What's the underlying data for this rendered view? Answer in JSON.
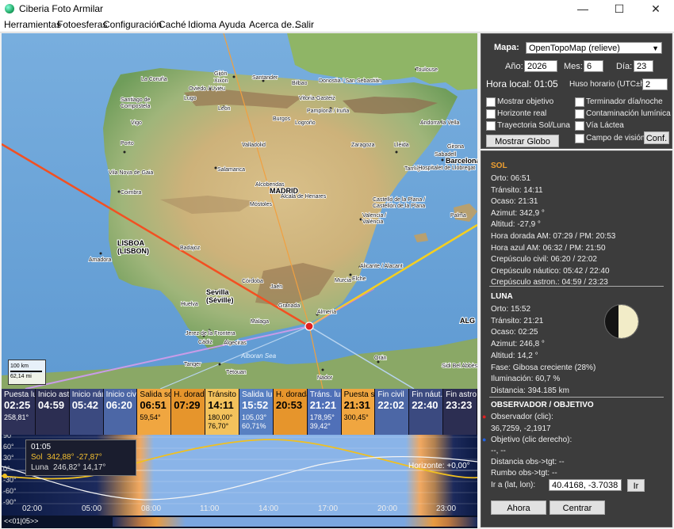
{
  "window": {
    "title": "Ciberia Foto Armilar",
    "min": "—",
    "max": "☐",
    "close": "✕"
  },
  "menu": [
    "Herramientas",
    "Fotoesferas",
    "Configuración",
    "Caché",
    "Idioma",
    "Ayuda",
    "Acerca de...",
    "Salir"
  ],
  "map": {
    "cities": [
      "Gijón",
      "Xixón",
      "La Coruña",
      "Oviedo / Uviéu",
      "Santander",
      "Bilbao",
      "Donostia / San Sebastián",
      "Toulouse",
      "Santiago de Compostela",
      "León",
      "Vitoria-Gasteiz",
      "Pamplona / Iruña",
      "Lugo",
      "Burgos",
      "Logroño",
      "Vigo",
      "Zaragoza",
      "Andorra la Vella",
      "Porto",
      "Valladolid",
      "Lleida",
      "Girona",
      "Vila Nova de Gaia",
      "Salamanca",
      "Tarragona",
      "Sabadell",
      "Barcelona",
      "L'Hospitalet de Llobregat",
      "Coimbra",
      "Alcobendas",
      "MADRID",
      "Alcalá de Henares",
      "Castelló de la Plana / Castellón de la Plana",
      "Móstoles",
      "Valencia / València",
      "Palma",
      "Badajoz",
      "LISBOA",
      "(LISBON)",
      "Amadora",
      "Alicante / Alacant",
      "Córdoba",
      "Elche",
      "Jaén",
      "Murcia",
      "Sevilla",
      "(Séville)",
      "Huelva",
      "Granada",
      "Almería",
      "Málaga",
      "Cádiz",
      "Jerez de la Frontera",
      "Algeciras",
      "Tanger",
      "Tétouan",
      "Nador",
      "Orán",
      "Sidi Bel Abbès",
      "Alboran Sea",
      "ALG"
    ],
    "scale": {
      "km": "100 km",
      "mi": "62,14 mi"
    }
  },
  "timeline": [
    {
      "label": "Puesta luna",
      "time": "02:25",
      "v1": "258,81°",
      "v2": "",
      "bg": "#2e3158",
      "fg": "#ffffff"
    },
    {
      "label": "Inicio astro",
      "time": "04:59",
      "v1": "",
      "v2": "",
      "bg": "#2c2e52",
      "fg": "#ffffff"
    },
    {
      "label": "Inicio náut.",
      "time": "05:42",
      "v1": "",
      "v2": "",
      "bg": "#3b4a80",
      "fg": "#ffffff"
    },
    {
      "label": "Inicio civil",
      "time": "06:20",
      "v1": "",
      "v2": "",
      "bg": "#4c67a6",
      "fg": "#ffffff"
    },
    {
      "label": "Salida sol",
      "time": "06:51",
      "v1": "59,54°",
      "v2": "",
      "bg": "#f0a640",
      "fg": "#000000"
    },
    {
      "label": "H. dorada",
      "time": "07:29",
      "v1": "",
      "v2": "",
      "bg": "#e6952c",
      "fg": "#000000"
    },
    {
      "label": "Tránsito sol",
      "time": "14:11",
      "v1": "180,00°",
      "v2": "76,70°",
      "bg": "#f3c25c",
      "fg": "#000000"
    },
    {
      "label": "Salida luna",
      "time": "15:52",
      "v1": "105,03°",
      "v2": "60,71%",
      "bg": "#5880c2",
      "fg": "#ffffff"
    },
    {
      "label": "H. dorada",
      "time": "20:53",
      "v1": "",
      "v2": "",
      "bg": "#e6952c",
      "fg": "#000000"
    },
    {
      "label": "Tráns. luna",
      "time": "21:21",
      "v1": "178,95°",
      "v2": "39,42°",
      "bg": "#5070b8",
      "fg": "#ffffff"
    },
    {
      "label": "Puesta sol",
      "time": "21:31",
      "v1": "300,45°",
      "v2": "",
      "bg": "#f0a640",
      "fg": "#000000"
    },
    {
      "label": "Fin civil",
      "time": "22:02",
      "v1": "",
      "v2": "",
      "bg": "#4c67a6",
      "fg": "#ffffff"
    },
    {
      "label": "Fin náut.",
      "time": "22:40",
      "v1": "",
      "v2": "",
      "bg": "#3b4a80",
      "fg": "#ffffff"
    },
    {
      "label": "Fin astro",
      "time": "23:23",
      "v1": "",
      "v2": "",
      "bg": "#2c2e52",
      "fg": "#ffffff"
    }
  ],
  "graph": {
    "yticks": [
      "90°",
      "60°",
      "30°",
      "0°",
      "-30°",
      "-60°",
      "-90°"
    ],
    "xticks": [
      "02:00",
      "05:00",
      "08:00",
      "11:00",
      "14:00",
      "17:00",
      "20:00",
      "23:00"
    ],
    "tooltip": {
      "time": "01:05",
      "sun_label": "Sol",
      "sun_value": "342,88°  -27,87°",
      "moon_label": "Luna",
      "moon_value": "246,82°  14,17°"
    },
    "horizon": "Horizonte: +0,00°"
  },
  "bottombar": {
    "nav": "<<01|05>>"
  },
  "controls": {
    "map_label": "Mapa:",
    "map_value": "OpenTopoMap (relieve)",
    "year_label": "Año:",
    "year": "2026",
    "month_label": "Mes:",
    "month": "6",
    "day_label": "Día:",
    "day": "23",
    "local_time": "Hora local: 01:05",
    "tz_label": "Huso horario (UTC±h):",
    "tz": "2",
    "checks": [
      "Mostrar objetivo",
      "Terminador día/noche",
      "Horizonte real",
      "Contaminación lumínica",
      "Trayectoria Sol/Luna",
      "Vía Láctea",
      "Campo de visión"
    ],
    "globe_btn": "Mostrar Globo",
    "conf_btn": "Conf."
  },
  "sun": {
    "title": "SOL",
    "lines": [
      "Orto: 06:51",
      "Tránsito: 14:11",
      "Ocaso: 21:31",
      "Azimut: 342,9 °",
      "Altitud: -27,9 °",
      "Hora dorada AM: 07:29  /  PM: 20:53",
      "Hora azul AM: 06:32  /  PM: 21:50",
      "Crepúsculo civil: 06:20  /  22:02",
      "Crepúsculo náutico: 05:42  /  22:40",
      "Crepúsculo astron.: 04:59  /  23:23"
    ]
  },
  "moon": {
    "title": "LUNA",
    "lines": [
      "Orto: 15:52",
      "Tránsito: 21:21",
      "Ocaso: 02:25",
      "Azimut: 246,8 °",
      "Altitud: 14,2 °",
      "Fase: Gibosa creciente (28%)",
      "Iluminación: 60,7 %",
      "Distancia: 394.185 km"
    ],
    "illumination": 0.607
  },
  "observer": {
    "title": "OBSERVADOR / OBJETIVO",
    "obs_label": "Observador (clic):",
    "obs_value": "36,7259, -2,1917",
    "tgt_label": "Objetivo (clic derecho):",
    "tgt_value": "--, --",
    "dist": "Distancia obs->tgt: --",
    "bearing": "Rumbo obs->tgt: --",
    "goto_label": "Ir a (lat, lon):",
    "goto_value": "40.4168, -3.7038",
    "goto_btn": "Ir",
    "now_btn": "Ahora",
    "center_btn": "Centrar"
  }
}
